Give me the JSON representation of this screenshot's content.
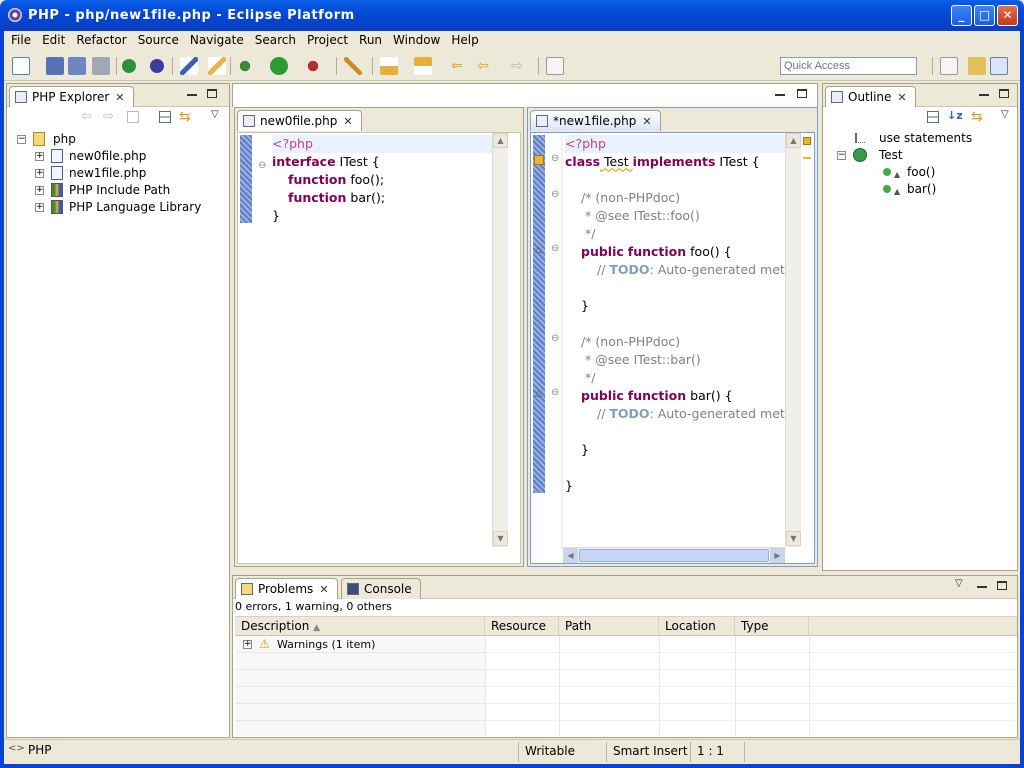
{
  "window": {
    "title": "PHP - php/new1file.php - Eclipse Platform"
  },
  "menu": [
    "File",
    "Edit",
    "Refactor",
    "Source",
    "Navigate",
    "Search",
    "Project",
    "Run",
    "Window",
    "Help"
  ],
  "quick_access": {
    "placeholder": "Quick Access"
  },
  "explorer": {
    "tab_label": "PHP Explorer",
    "items": [
      {
        "label": "php"
      },
      {
        "label": "new0file.php"
      },
      {
        "label": "new1file.php"
      },
      {
        "label": "PHP Include Path"
      },
      {
        "label": "PHP Language Library"
      }
    ]
  },
  "editor_left": {
    "tab_label": "new0file.php",
    "lines": {
      "l1": "<?php",
      "l2_kw": "interface",
      "l2_rest": " ITest {",
      "l3_kw": "function",
      "l3_rest": " foo();",
      "l4_kw": "function",
      "l4_rest": " bar();",
      "l5": "}"
    }
  },
  "editor_right": {
    "tab_label": "*new1file.php",
    "lines": {
      "l1": "<?php",
      "l2_kw1": "class",
      "l2_mid": " Test ",
      "l2_kw2": "implements",
      "l2_rest": " ITest {",
      "c1": "/* (non-PHPdoc)",
      "c2": " * @see ITest::foo()",
      "c3": " */",
      "f1_kw1": "public",
      "f1_kw2": "function",
      "f1_rest": " foo() {",
      "t1_pre": "// ",
      "t1_td": "TODO",
      "t1_rest": ": Auto-generated metho",
      "b1": "}",
      "c4": "/* (non-PHPdoc)",
      "c5": " * @see ITest::bar()",
      "c6": " */",
      "f2_kw1": "public",
      "f2_kw2": "function",
      "f2_rest": " bar() {",
      "t2_pre": "// ",
      "t2_td": "TODO",
      "t2_rest": ": Auto-generated metho",
      "b2": "}",
      "b3": "}"
    }
  },
  "outline": {
    "tab_label": "Outline",
    "items": [
      {
        "label": "use statements"
      },
      {
        "label": "Test"
      },
      {
        "label": "foo()"
      },
      {
        "label": "bar()"
      }
    ]
  },
  "problems": {
    "tab_label": "Problems",
    "console_label": "Console",
    "summary": "0 errors, 1 warning, 0 others",
    "columns": [
      "Description",
      "Resource",
      "Path",
      "Location",
      "Type"
    ],
    "rows": [
      {
        "description": "Warnings (1 item)"
      }
    ]
  },
  "status": {
    "perspective": "PHP",
    "writable": "Writable",
    "insert_mode": "Smart Insert",
    "position": "1 : 1"
  },
  "colors": {
    "title_blue": "#0247d5",
    "keyword": "#7f0055",
    "php_tag": "#c8407e",
    "comment": "#808080",
    "todo": "#7f9fbf"
  }
}
